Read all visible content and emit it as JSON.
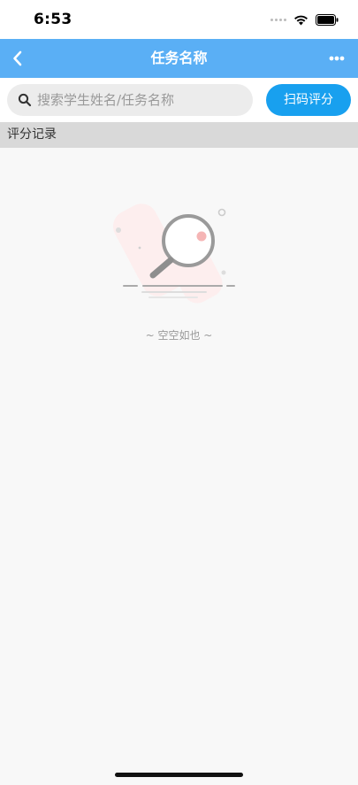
{
  "status_bar": {
    "time": "6:53"
  },
  "nav": {
    "title": "任务名称",
    "back_icon": "chevron-left-icon",
    "more_icon": "more-dots-icon"
  },
  "search": {
    "placeholder": "搜索学生姓名/任务名称",
    "icon": "search-icon"
  },
  "scan_button": {
    "label": "扫码评分"
  },
  "section": {
    "title": "评分记录"
  },
  "empty_state": {
    "message": "~ 空空如也 ~",
    "icon": "empty-search-illustration"
  },
  "colors": {
    "nav_bg": "#5aaff5",
    "scan_button_bg": "#18a0ef",
    "section_bg": "#d9d9d9",
    "search_bg": "#ececec"
  }
}
